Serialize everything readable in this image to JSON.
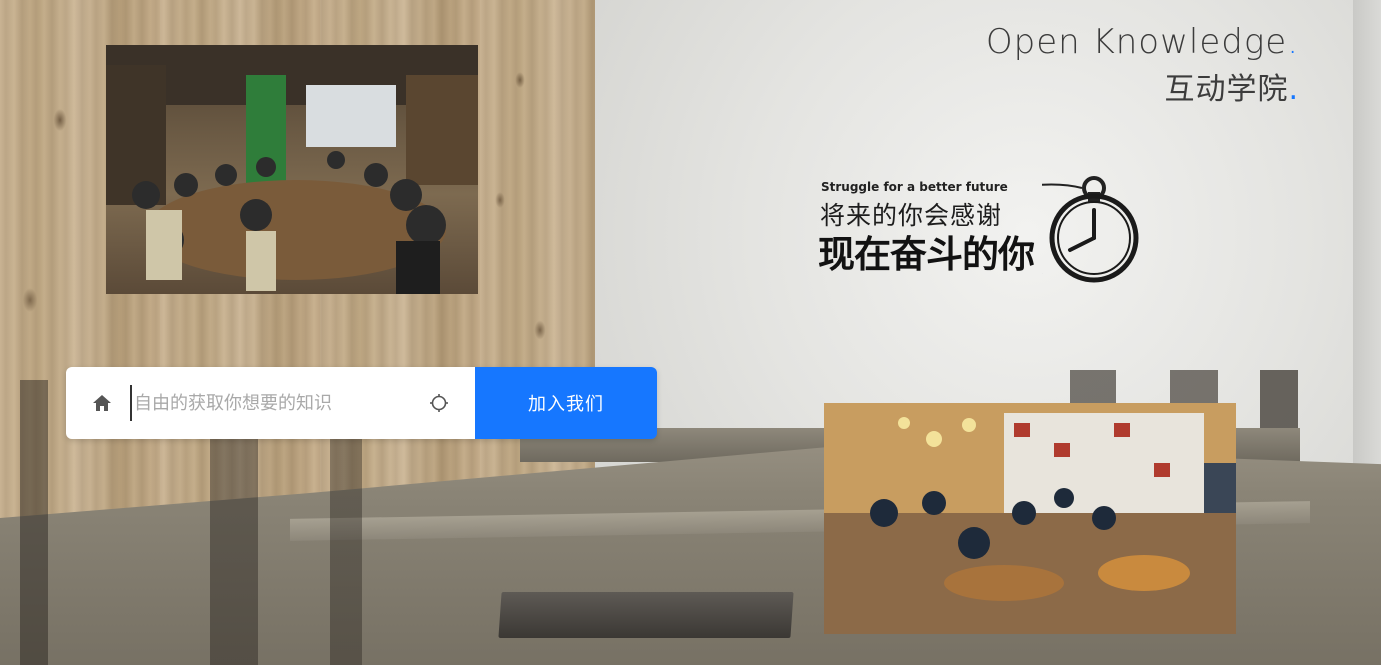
{
  "brand": {
    "title_en": "Open Knowledge",
    "title_cn": "互动学院",
    "dot": ".",
    "accent_color": "#1677ff"
  },
  "decal": {
    "small_text": "Struggle for a better future",
    "line1": "将来的你会感谢",
    "line2": "现在奋斗的你",
    "icon": "stopwatch-icon"
  },
  "search": {
    "placeholder": "自由的获取你想要的知识",
    "value": "",
    "left_icon": "home-icon",
    "right_icon": "locate-icon",
    "button_label": "加入我们"
  },
  "photos": {
    "top": "lecture-room-photo",
    "bottom": "cafe-study-room-photo"
  }
}
